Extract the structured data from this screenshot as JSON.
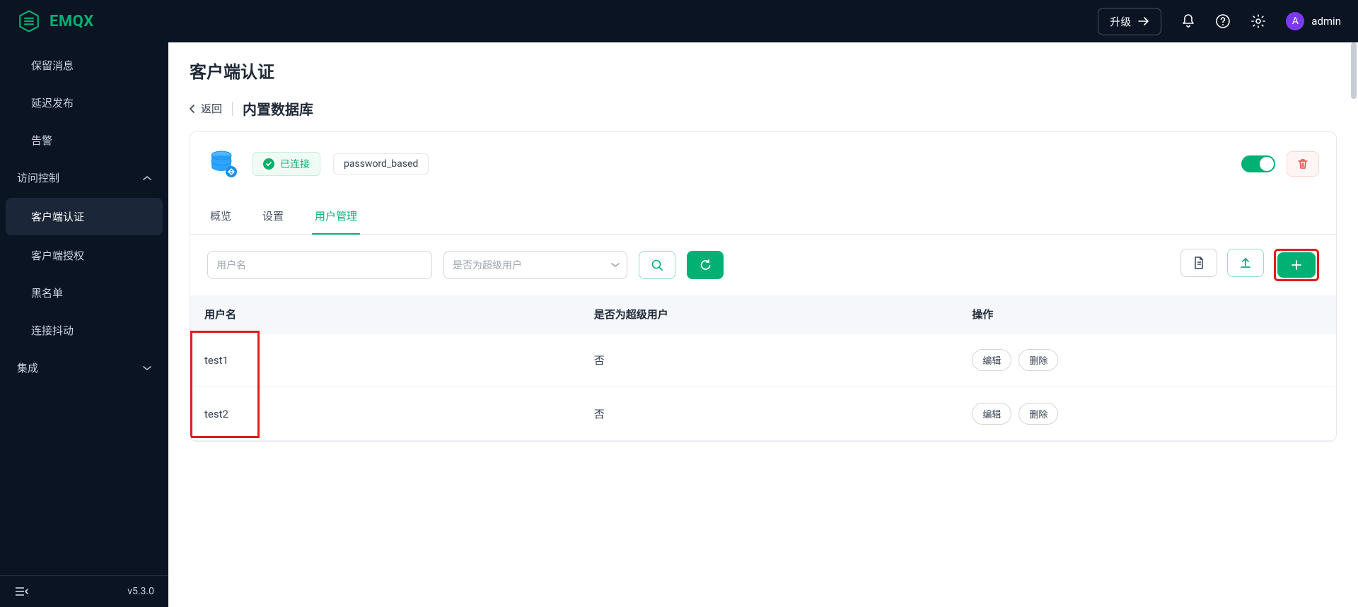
{
  "header": {
    "brand": "EMQX",
    "upgrade_label": "升级",
    "user_initial": "A",
    "user_name": "admin"
  },
  "sidebar": {
    "simple_items": [
      {
        "label": "保留消息"
      },
      {
        "label": "延迟发布"
      },
      {
        "label": "告警"
      }
    ],
    "group_access": {
      "title": "访问控制",
      "items": [
        {
          "label": "客户端认证",
          "active": true
        },
        {
          "label": "客户端授权"
        },
        {
          "label": "黑名单"
        },
        {
          "label": "连接抖动"
        }
      ]
    },
    "group_integration": {
      "title": "集成"
    },
    "version": "v5.3.0"
  },
  "page": {
    "title": "客户端认证",
    "back_label": "返回",
    "subtitle": "内置数据库",
    "status_label": "已连接",
    "mechanism_label": "password_based",
    "tabs": [
      {
        "label": "概览"
      },
      {
        "label": "设置"
      },
      {
        "label": "用户管理",
        "active": true
      }
    ],
    "toolbar": {
      "username_placeholder": "用户名",
      "superuser_placeholder": "是否为超级用户"
    },
    "table": {
      "columns": {
        "username": "用户名",
        "superuser": "是否为超级用户",
        "actions": "操作"
      },
      "rows": [
        {
          "username": "test1",
          "superuser": "否"
        },
        {
          "username": "test2",
          "superuser": "否"
        }
      ],
      "edit_label": "编辑",
      "delete_label": "删除"
    }
  }
}
